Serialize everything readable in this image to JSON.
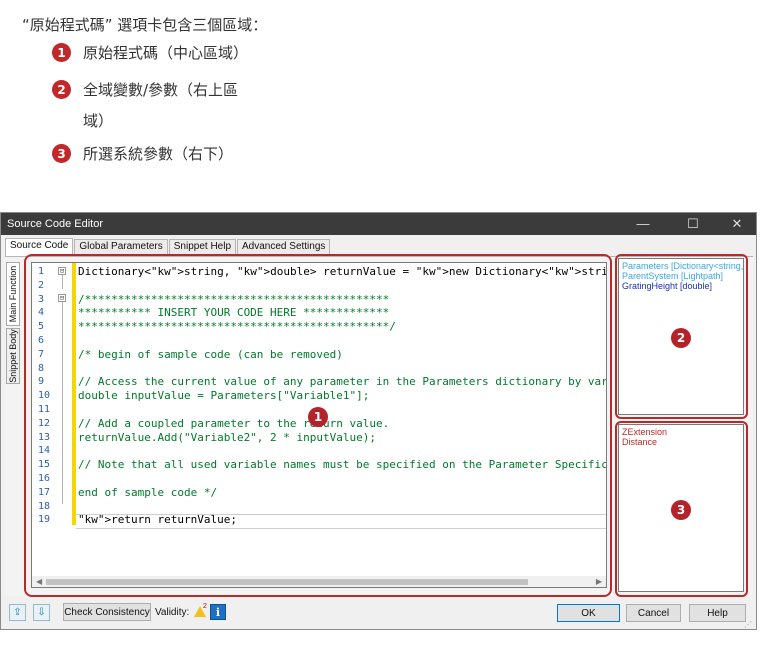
{
  "doc": {
    "intro": "“原始程式碼” 選項卡包含三個區域：",
    "items": [
      {
        "num": "1",
        "text": "原始程式碼（中心區域）"
      },
      {
        "num": "2",
        "text": "全域變數/參數（右上區"
      },
      {
        "num": "3",
        "text": "所選系統參數（右下）"
      }
    ],
    "item2_cont": "域）"
  },
  "window": {
    "title": "Source Code Editor",
    "controls": {
      "minimize": "—",
      "maximize": "☐",
      "close": "✕"
    },
    "tabs": [
      "Source Code",
      "Global Parameters",
      "Snippet Help",
      "Advanced Settings"
    ],
    "side_tabs": [
      "Main Function",
      "Snippet Body"
    ]
  },
  "editor": {
    "line_numbers": [
      "1",
      "2",
      "3",
      "4",
      "5",
      "6",
      "7",
      "8",
      "9",
      "10",
      "11",
      "12",
      "13",
      "14",
      "15",
      "16",
      "17",
      "18",
      "19"
    ],
    "lines": [
      "Dictionary<string, double> returnValue = new Dictionary<string, double>();",
      "",
      "/**********************************************",
      "*********** INSERT YOUR CODE HERE *************",
      "***********************************************/",
      "",
      "/* begin of sample code (can be removed)",
      "",
      "// Access the current value of any parameter in the Parameters dictionary by vari",
      "double inputValue = Parameters[\"Variable1\"];",
      "",
      "// Add a coupled parameter to the return value.",
      "returnValue.Add(\"Variable2\", 2 * inputValue);",
      "",
      "// Note that all used variable names must be specified on the Parameter Specifica",
      "",
      "end of sample code */",
      "",
      "return returnValue;"
    ],
    "fold_markers": [
      "⊟",
      "⊟"
    ]
  },
  "badges": [
    "1",
    "2",
    "3"
  ],
  "global_params": [
    {
      "text": "Parameters [Dictionary<string, do",
      "color": "#3aa8e6"
    },
    {
      "text": "ParentSystem [Lightpath]",
      "color": "#3aa8e6"
    },
    {
      "text": "GratingHeight [double]",
      "color": "#1f2fb8"
    }
  ],
  "system_params": [
    {
      "text": "ZExtension",
      "color": "#c0282a"
    },
    {
      "text": "Distance",
      "color": "#c0282a"
    }
  ],
  "footer": {
    "check_label": "Check Consistency",
    "validity_label": "Validity:",
    "warning_count": "2",
    "info_glyph": "i",
    "ok_label": "OK",
    "cancel_label": "Cancel",
    "help_label": "Help"
  }
}
